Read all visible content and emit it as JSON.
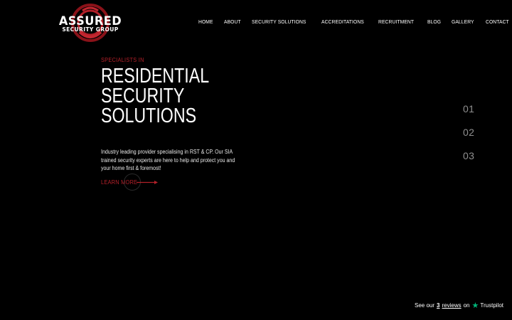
{
  "brand": {
    "logo_word": "ASSURED",
    "logo_sub": "SECURITY GROUP",
    "accent_color": "#b32029"
  },
  "nav": {
    "items": [
      {
        "label": "HOME"
      },
      {
        "label": "ABOUT"
      },
      {
        "label": "SECURITY SOLUTIONS"
      },
      {
        "label": "ACCREDITATIONS"
      },
      {
        "label": "RECRUITMENT"
      },
      {
        "label": "BLOG"
      },
      {
        "label": "GALLERY"
      },
      {
        "label": "CONTACT"
      }
    ]
  },
  "hero": {
    "kicker": "SPECIALISTS IN",
    "headline_lines": [
      "RESIDENTIAL",
      "SECURITY",
      "SOLUTIONS"
    ],
    "description": "Industry leading provider specialising in RST & CP. Our SIA trained security experts are here to help and protect you and your home first & foremost!",
    "cta_label": "LEARN MORE"
  },
  "slider": {
    "slides": [
      "01",
      "02",
      "03"
    ]
  },
  "trustpilot": {
    "prefix": "See our",
    "count": "3",
    "reviews_word": "reviews",
    "on_word": "on",
    "brand": "Trustpilot",
    "star_icon": "star-icon",
    "star_color": "#00b67a"
  }
}
